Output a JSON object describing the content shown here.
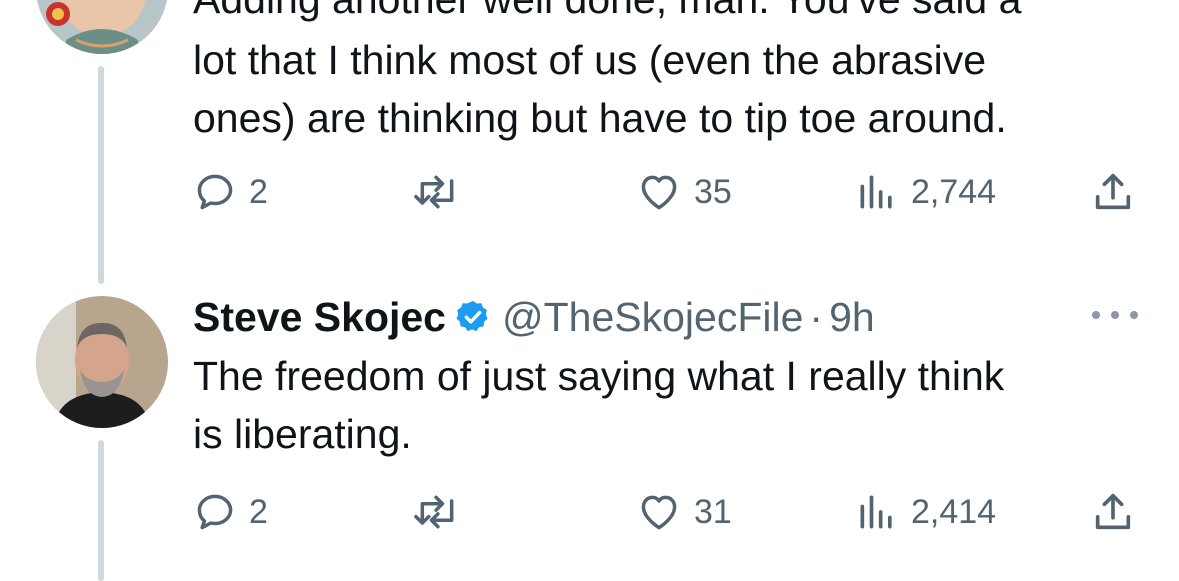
{
  "tweets": [
    {
      "text_partial_top": "Adding another well done, man. You've said a",
      "text": "lot that I think most of us (even the abrasive\nones) are thinking but have to tip toe around.",
      "stats": {
        "replies": "2",
        "likes": "35",
        "views": "2,744"
      }
    },
    {
      "author": {
        "name": "Steve Skojec",
        "handle": "@TheSkojecFile",
        "separator": "·",
        "time": "9h"
      },
      "text": "The freedom of just saying what I really think\nis liberating.",
      "stats": {
        "replies": "2",
        "likes": "31",
        "views": "2,414"
      }
    }
  ],
  "icons": {
    "reply": "speech-bubble",
    "repost": "two-arrows-loop",
    "like": "heart",
    "views": "bar-chart",
    "share": "upload-arrow",
    "verified": "blue-badge-check",
    "more": "three-dots"
  },
  "colors": {
    "text": "#0f1419",
    "muted": "#536471",
    "thread_line": "#cfd9de",
    "verified": "#1d9bf0"
  }
}
